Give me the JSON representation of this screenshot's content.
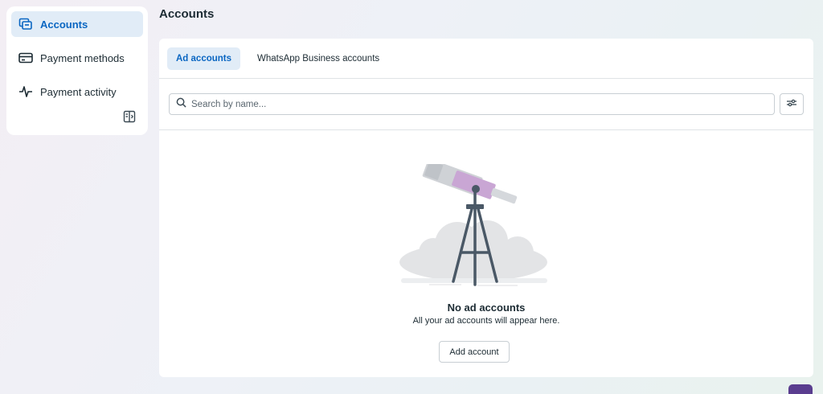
{
  "sidebar": {
    "items": [
      {
        "label": "Accounts",
        "icon": "accounts-icon",
        "active": true
      },
      {
        "label": "Payment methods",
        "icon": "credit-card-icon",
        "active": false
      },
      {
        "label": "Payment activity",
        "icon": "activity-pulse-icon",
        "active": false
      }
    ],
    "collapse_icon": "collapse-sidebar-icon"
  },
  "page": {
    "title": "Accounts"
  },
  "tabs": [
    {
      "label": "Ad accounts",
      "active": true
    },
    {
      "label": "WhatsApp Business accounts",
      "active": false
    }
  ],
  "search": {
    "placeholder": "Search by name...",
    "value": ""
  },
  "empty_state": {
    "title": "No ad accounts",
    "subtitle": "All your ad accounts will appear here.",
    "button_label": "Add account",
    "illustration": "telescope-illustration"
  },
  "colors": {
    "accent": "#0a66c2",
    "active_bg": "#e1ecf7",
    "help_button": "#5a3d8f"
  }
}
